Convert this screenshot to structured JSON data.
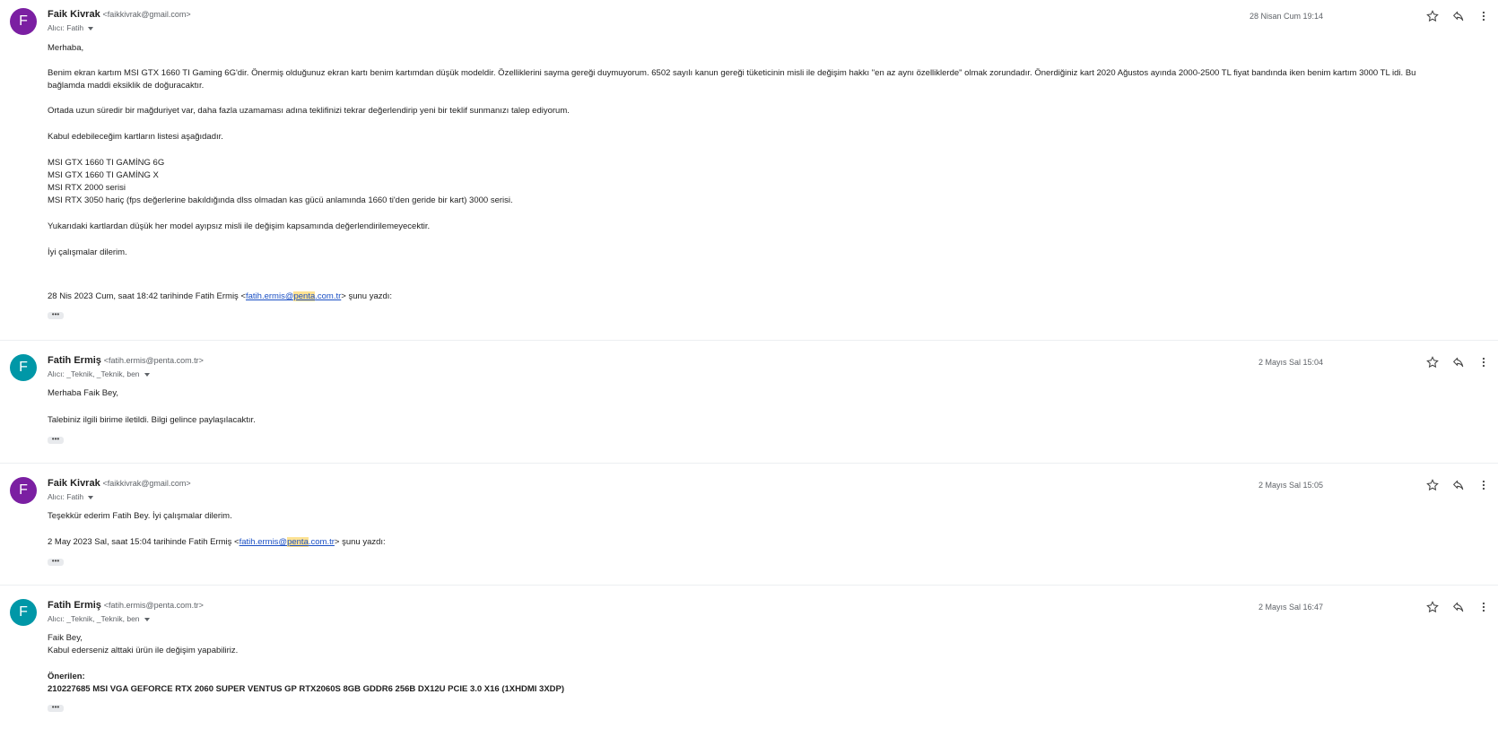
{
  "messages": [
    {
      "avatar_letter": "F",
      "avatar_color": "#7b1fa2",
      "sender_name": "Faik Kivrak",
      "sender_email": "<faikkivrak@gmail.com>",
      "to": "Alıcı: Fatih",
      "date": "28 Nisan Cum 19:14",
      "body": [
        "Merhaba,",
        "Benim ekran kartım MSI GTX 1660 TI Gaming 6G'dir. Önermiş olduğunuz ekran kartı benim kartımdan düşük modeldir. Özelliklerini sayma gereği duymuyorum. 6502 sayılı kanun gereği tüketicinin misli ile değişim hakkı \"en az aynı özelliklerde\" olmak zorundadır. Önerdiğiniz kart 2020 Ağustos ayında 2000-2500 TL fiyat bandında iken benim kartım 3000 TL idi. Bu",
        "bağlamda maddi eksiklik de doğuracaktır.",
        "Ortada uzun süredir bir mağduriyet var, daha fazla uzamaması adına teklifinizi tekrar değerlendirip yeni bir teklif sunmanızı talep ediyorum.",
        "Kabul edebileceğim kartların listesi aşağıdadır.",
        "MSI GTX 1660 TI GAMİNG 6G",
        "MSI GTX 1660 TI GAMİNG X",
        "MSI RTX 2000 serisi",
        "MSI RTX 3050 hariç (fps değerlerine bakıldığında dlss olmadan kas gücü anlamında 1660 ti'den geride bir kart) 3000 serisi.",
        "Yukarıdaki kartlardan düşük her model ayıpsız misli ile değişim kapsamında değerlendirilemeyecektir.",
        "İyi çalışmalar dilerim."
      ],
      "quote_prefix": "28 Nis 2023 Cum, saat 18:42 tarihinde Fatih Ermiş <",
      "quote_link_a": "fatih.ermis@",
      "quote_link_hl": "penta",
      "quote_link_b": ".com.tr",
      "quote_suffix": "> şunu yazdı:",
      "dots": "•••"
    },
    {
      "avatar_letter": "F",
      "avatar_color": "#0097a7",
      "sender_name": "Fatih Ermiş",
      "sender_email": "<fatih.ermis@penta.com.tr>",
      "to": "Alıcı: _Teknik, _Teknik, ben",
      "date": "2 Mayıs Sal 15:04",
      "body": [
        "Merhaba Faik Bey,",
        "Talebiniz ilgili birime iletildi. Bilgi gelince paylaşılacaktır."
      ],
      "dots": "•••"
    },
    {
      "avatar_letter": "F",
      "avatar_color": "#7b1fa2",
      "sender_name": "Faik Kivrak",
      "sender_email": "<faikkivrak@gmail.com>",
      "to": "Alıcı: Fatih",
      "date": "2 Mayıs Sal 15:05",
      "body": [
        "Teşekkür ederim Fatih Bey. İyi çalışmalar dilerim."
      ],
      "quote_prefix": "2 May 2023 Sal, saat 15:04 tarihinde Fatih Ermiş <",
      "quote_link_a": "fatih.ermis@",
      "quote_link_hl": "penta",
      "quote_link_b": ".com.tr",
      "quote_suffix": "> şunu yazdı:",
      "dots": "•••"
    },
    {
      "avatar_letter": "F",
      "avatar_color": "#0097a7",
      "sender_name": "Fatih Ermiş",
      "sender_email": "<fatih.ermis@penta.com.tr>",
      "to": "Alıcı: _Teknik, _Teknik, ben",
      "date": "2 Mayıs Sal 16:47",
      "body": [
        "Faik Bey,",
        "Kabul ederseniz alttaki ürün ile değişim yapabiliriz.",
        "Önerilen:",
        "210227685  MSI VGA GEFORCE RTX 2060 SUPER VENTUS GP RTX2060S 8GB GDDR6 256B DX12U PCIE 3.0 X16 (1XHDMI 3XDP)"
      ],
      "dots": "•••"
    }
  ],
  "icons": {
    "star": "star-icon",
    "reply": "reply-icon",
    "more": "more-vert-icon"
  }
}
